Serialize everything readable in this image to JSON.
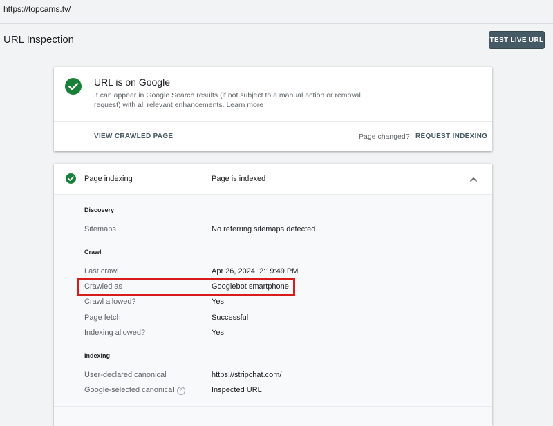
{
  "url_bar": {
    "url": "https://topcams.tv/"
  },
  "header": {
    "title": "URL Inspection",
    "test_live_url_label": "TEST LIVE URL"
  },
  "status_card": {
    "heading": "URL is on Google",
    "description": "It can appear in Google Search results (if not subject to a manual action or removal request) with all relevant enhancements.",
    "learn_more": "Learn more",
    "view_crawled_label": "VIEW CRAWLED PAGE",
    "page_changed_text": "Page changed?",
    "request_indexing_label": "REQUEST INDEXING"
  },
  "indexing_card": {
    "label": "Page indexing",
    "status": "Page is indexed",
    "sections": {
      "discovery": {
        "title": "Discovery",
        "rows": [
          {
            "label": "Sitemaps",
            "value": "No referring sitemaps detected"
          }
        ]
      },
      "crawl": {
        "title": "Crawl",
        "rows": [
          {
            "label": "Last crawl",
            "value": "Apr 26, 2024, 2:19:49 PM"
          },
          {
            "label": "Crawled as",
            "value": "Googlebot smartphone"
          },
          {
            "label": "Crawl allowed?",
            "value": "Yes"
          },
          {
            "label": "Page fetch",
            "value": "Successful"
          },
          {
            "label": "Indexing allowed?",
            "value": "Yes"
          }
        ]
      },
      "indexing": {
        "title": "Indexing",
        "rows": [
          {
            "label": "User-declared canonical",
            "value": "https://stripchat.com/"
          },
          {
            "label": "Google-selected canonical",
            "value": "Inspected URL"
          }
        ]
      }
    }
  },
  "colors": {
    "check_green": "#188038",
    "highlight_red": "#d81b1b",
    "button_bg": "#455a64"
  },
  "icons": {
    "status": "check-circle-icon",
    "section_status": "check-circle-icon",
    "collapse": "chevron-up-icon",
    "help": "help-circle-icon"
  }
}
